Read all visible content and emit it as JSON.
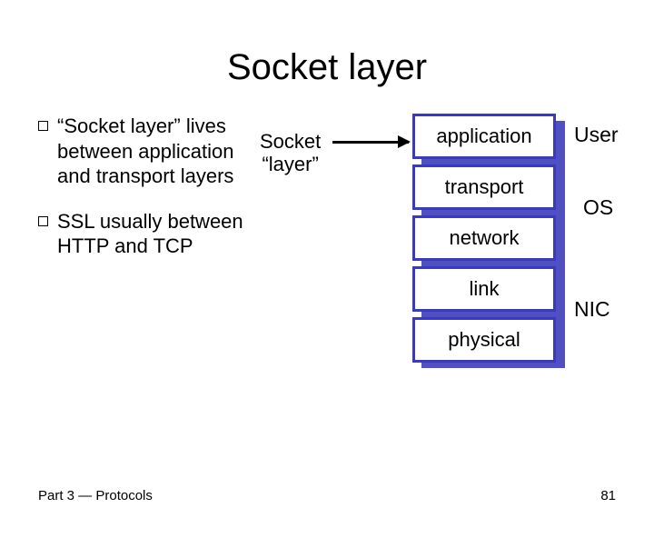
{
  "title": "Socket layer",
  "bullets": [
    "“Socket layer” lives between application and transport layers",
    "SSL usually between HTTP and TCP"
  ],
  "diagram": {
    "socket_label_line1": "Socket",
    "socket_label_line2": "“layer”",
    "layers": {
      "application": "application",
      "transport": "transport",
      "network": "network",
      "link": "link",
      "physical": "physical"
    },
    "side": {
      "user": "User",
      "os": "OS",
      "nic": "NIC"
    }
  },
  "footer": {
    "left": "Part 3 — Protocols",
    "page": "81"
  }
}
